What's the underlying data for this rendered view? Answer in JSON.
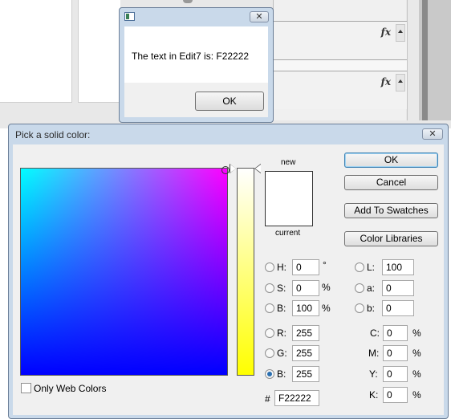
{
  "message_box": {
    "text": "The text in Edit7 is: F22222",
    "ok_label": "OK",
    "close_glyph": "✕"
  },
  "picker": {
    "title": "Pick a solid color:",
    "close_glyph": "✕",
    "new_label": "new",
    "current_label": "current",
    "new_color": "#ffffff",
    "buttons": {
      "ok": "OK",
      "cancel": "Cancel",
      "add_to_swatches": "Add To Swatches",
      "color_libraries": "Color Libraries"
    },
    "only_web_colors_label": "Only Web Colors",
    "hsb": {
      "h": {
        "label": "H:",
        "value": "0",
        "unit": "°"
      },
      "s": {
        "label": "S:",
        "value": "0",
        "unit": "%"
      },
      "b": {
        "label": "B:",
        "value": "100",
        "unit": "%"
      }
    },
    "rgb": {
      "r": {
        "label": "R:",
        "value": "255"
      },
      "g": {
        "label": "G:",
        "value": "255"
      },
      "b": {
        "label": "B:",
        "value": "255"
      }
    },
    "lab": {
      "l": {
        "label": "L:",
        "value": "100"
      },
      "a": {
        "label": "a:",
        "value": "0"
      },
      "b": {
        "label": "b:",
        "value": "0"
      }
    },
    "cmyk": {
      "c": {
        "label": "C:",
        "value": "0",
        "unit": "%"
      },
      "m": {
        "label": "M:",
        "value": "0",
        "unit": "%"
      },
      "y": {
        "label": "Y:",
        "value": "0",
        "unit": "%"
      },
      "k": {
        "label": "K:",
        "value": "0",
        "unit": "%"
      }
    },
    "hex": {
      "label": "#",
      "value": "F22222"
    },
    "selected_channel": "B (RGB)"
  },
  "background_app": {
    "fx_label": "fx"
  }
}
